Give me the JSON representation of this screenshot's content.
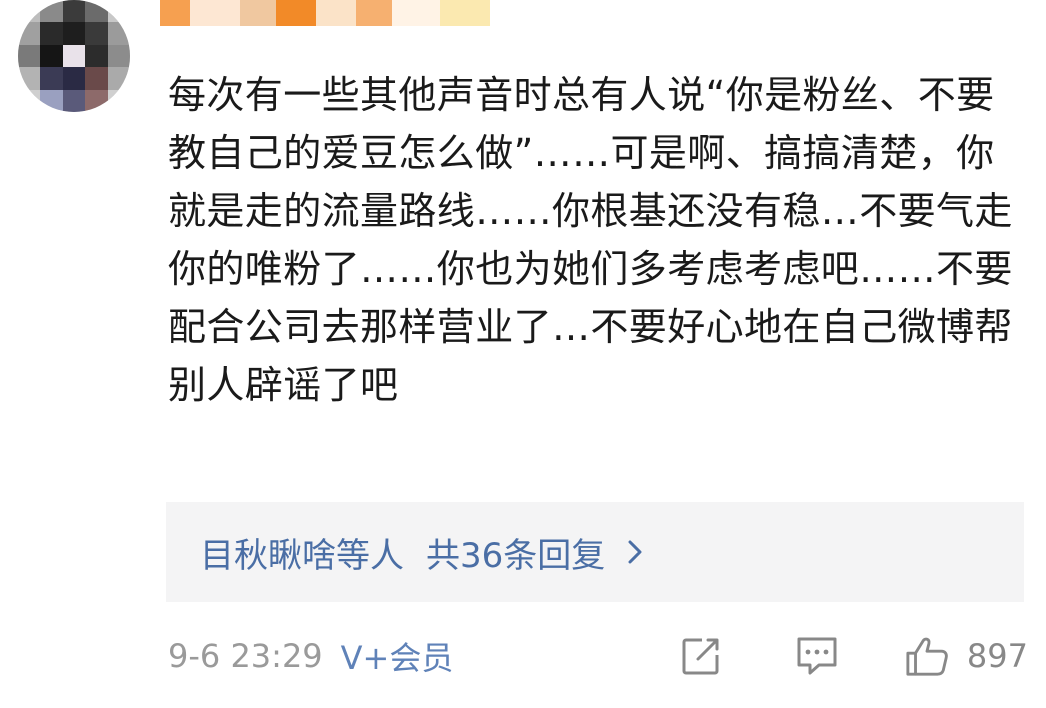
{
  "comment": {
    "text": "每次有一些其他声音时总有人说“你是粉丝、不要教自己的爱豆怎么做”……可是啊、搞搞清楚，你就是走的流量路线……你根基还没有稳…不要气走你的唯粉了……你也为她们多考虑考虑吧……不要配合公司去那样营业了…不要好心地在自己微博帮别人辟谣了吧"
  },
  "replies": {
    "names": "目秋瞅啥等人",
    "count_label": "共36条回复"
  },
  "footer": {
    "time": "9-6 23:29",
    "vip": "V+会员",
    "like_count": "897"
  },
  "icons": {
    "edit": "edit-icon",
    "comment": "comment-icon",
    "like": "thumbs-up-icon",
    "chevron": "chevron-right-icon"
  },
  "colors": {
    "link_blue": "#4a6ea5",
    "muted_gray": "#9a9a9a",
    "reply_bg": "#f4f4f5"
  }
}
